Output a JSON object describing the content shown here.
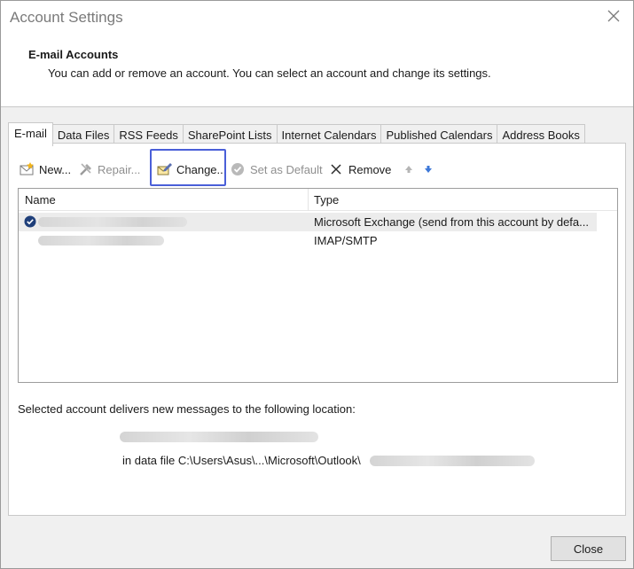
{
  "window": {
    "title": "Account Settings"
  },
  "header": {
    "title": "E-mail Accounts",
    "subtitle": "You can add or remove an account. You can select an account and change its settings."
  },
  "tabs": [
    {
      "label": "E-mail",
      "active": true
    },
    {
      "label": "Data Files"
    },
    {
      "label": "RSS Feeds"
    },
    {
      "label": "SharePoint Lists"
    },
    {
      "label": "Internet Calendars"
    },
    {
      "label": "Published Calendars"
    },
    {
      "label": "Address Books"
    }
  ],
  "toolbar": {
    "new_label": "New...",
    "repair_label": "Repair...",
    "change_label": "Change...",
    "set_default_label": "Set as Default",
    "remove_label": "Remove"
  },
  "accounts": {
    "columns": {
      "name": "Name",
      "type": "Type"
    },
    "rows": [
      {
        "type": "Microsoft Exchange (send from this account by defa...",
        "selected": true,
        "default": true
      },
      {
        "type": "IMAP/SMTP",
        "selected": false,
        "default": false
      }
    ]
  },
  "delivery": {
    "label": "Selected account delivers new messages to the following location:",
    "data_file": "in data file C:\\Users\\Asus\\...\\Microsoft\\Outlook\\"
  },
  "footer": {
    "close_label": "Close"
  },
  "colors": {
    "highlight": "#4a5fd8",
    "default_check": "#1f3f7a"
  }
}
